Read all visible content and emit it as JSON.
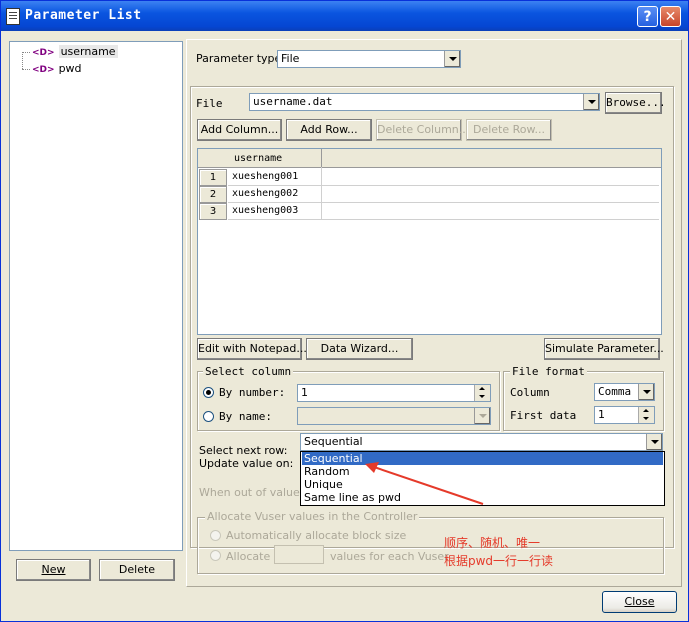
{
  "window": {
    "title": "Parameter List",
    "help_label": "?",
    "close_label": "✕"
  },
  "tree": {
    "items": [
      "username",
      "pwd"
    ]
  },
  "left_buttons": {
    "new_label": "New",
    "delete_label": "Delete"
  },
  "param_type": {
    "label": "Parameter type:",
    "value": "File"
  },
  "file": {
    "label": "File",
    "value": "username.dat",
    "browse_label": "Browse..."
  },
  "toolbar": {
    "add_column": "Add Column...",
    "add_row": "Add Row...",
    "delete_column": "Delete Column...",
    "delete_row": "Delete Row..."
  },
  "table": {
    "columns": [
      "username"
    ],
    "rows": [
      {
        "num": "1",
        "username": "xuesheng001"
      },
      {
        "num": "2",
        "username": "xuesheng002"
      },
      {
        "num": "3",
        "username": "xuesheng003"
      }
    ]
  },
  "actions": {
    "edit_notepad": "Edit with Notepad...",
    "data_wizard": "Data Wizard...",
    "simulate": "Simulate Parameter..."
  },
  "select_column": {
    "title": "Select column",
    "by_number_label": "By number:",
    "by_number_value": "1",
    "by_name_label": "By name:"
  },
  "file_format": {
    "title": "File format",
    "column_label": "Column",
    "column_value": "Comma",
    "first_data_label": "First data",
    "first_data_value": "1"
  },
  "next_row": {
    "label": "Select next row:",
    "value": "Sequential",
    "update_label": "Update value on:",
    "out_of_values_label": "When out of values:"
  },
  "dropdown_options": [
    "Sequential",
    "Random",
    "Unique",
    "Same line as pwd"
  ],
  "allocate": {
    "title": "Allocate Vuser values in the Controller",
    "auto_label": "Automatically allocate block size",
    "allocate_label": "Allocate",
    "each_vuser_label": "values for each Vuser"
  },
  "annotation": {
    "line1": "顺序、随机、唯一",
    "line2": "根据pwd一行一行读"
  },
  "footer": {
    "close_label": "Close"
  },
  "colors": {
    "title_bar": "#0a55e0",
    "selection": "#316ac5",
    "annotation": "#e53a2a"
  }
}
